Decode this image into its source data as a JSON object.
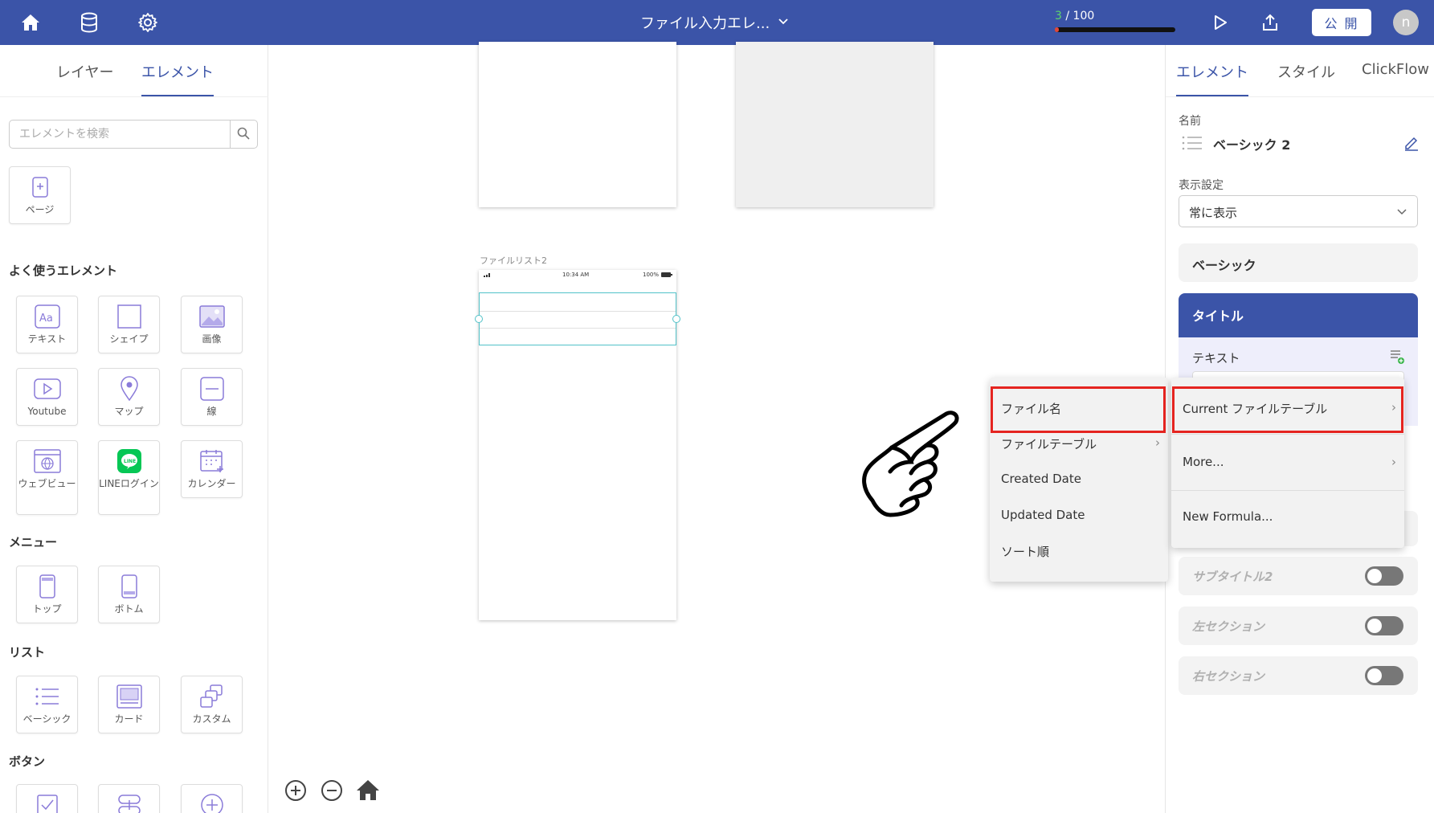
{
  "topbar": {
    "title": "ファイル入力エレ...",
    "progress_current": "3",
    "progress_total": " / 100",
    "progress_fraction": 0.03,
    "publish_label": "公 開",
    "avatar_initial": "n"
  },
  "left_panel": {
    "tabs": [
      "レイヤー",
      "エレメント"
    ],
    "active_tab": "エレメント",
    "search_placeholder": "エレメントを検索",
    "page_tile": "ページ",
    "sections": {
      "common": "よく使うエレメント",
      "menu": "メニュー",
      "list": "リスト",
      "button": "ボタン"
    },
    "common_items": [
      "テキスト",
      "シェイプ",
      "画像",
      "Youtube",
      "マップ",
      "線",
      "ウェブビュー",
      "LINEログイン",
      "カレンダー"
    ],
    "menu_items": [
      "トップ",
      "ボトム"
    ],
    "list_items": [
      "ベーシック",
      "カード",
      "カスタム"
    ]
  },
  "canvas": {
    "frame_label": "ファイルリスト2",
    "status_time": "10:34 AM",
    "status_battery": "100%"
  },
  "right_panel": {
    "tabs": [
      "エレメント",
      "スタイル",
      "ClickFlow"
    ],
    "active_tab": "エレメント",
    "name_label": "名前",
    "name_value": "ベーシック 2",
    "visibility_label": "表示設定",
    "visibility_value": "常に表示",
    "basic_card": "ベーシック",
    "title_card": "タイトル",
    "text_label": "テキスト",
    "toggles": [
      {
        "label": "サブタイトル2",
        "on": false
      },
      {
        "label": "左セクション",
        "on": false
      },
      {
        "label": "右セクション",
        "on": false
      }
    ]
  },
  "menu_primary": {
    "items": [
      "ファイル名",
      "ファイルテーブル",
      "Created Date",
      "Updated Date",
      "ソート順"
    ]
  },
  "menu_secondary": {
    "items": [
      "Current ファイルテーブル",
      "More...",
      "New Formula..."
    ]
  },
  "colors": {
    "brand": "#3b54a8",
    "highlight": "#e52420",
    "selection": "#52c2c8"
  }
}
